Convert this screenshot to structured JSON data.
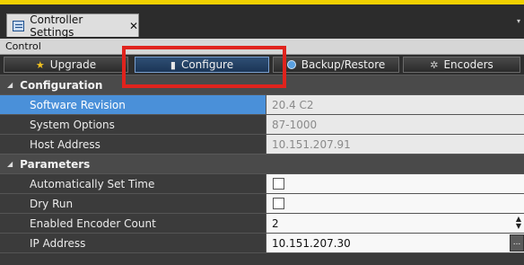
{
  "window": {
    "tab_title": "Controller Settings",
    "tab_close": "✕",
    "tab_icon": "settings-window-icon",
    "overflow": "▾"
  },
  "control_bar": {
    "label": "Control"
  },
  "toolbar": {
    "buttons": [
      {
        "label": "Upgrade",
        "icon": "star-icon"
      },
      {
        "label": "Configure",
        "icon": "document-icon",
        "active": true
      },
      {
        "label": "Backup/Restore",
        "icon": "disk-icon"
      },
      {
        "label": "Encoders",
        "icon": "gear-icon"
      }
    ]
  },
  "configuration": {
    "header": "Configuration",
    "rows": [
      {
        "name": "Software Revision",
        "value": "20.4 C2",
        "selected": true
      },
      {
        "name": "System Options",
        "value": "87-1000"
      },
      {
        "name": "Host Address",
        "value": "10.151.207.91"
      }
    ]
  },
  "parameters": {
    "header": "Parameters",
    "rows": [
      {
        "name": "Automatically Set Time",
        "checked": false
      },
      {
        "name": "Dry Run",
        "checked": false
      },
      {
        "name": "Enabled Encoder Count",
        "value": "2"
      },
      {
        "name": "IP Address",
        "value": "10.151.207.30",
        "browse": "..."
      }
    ]
  },
  "colors": {
    "highlight_box": "#e0231d",
    "selected_row": "#4a90d9",
    "active_button": "#2f4f75",
    "top_strip": "#f0d000"
  }
}
